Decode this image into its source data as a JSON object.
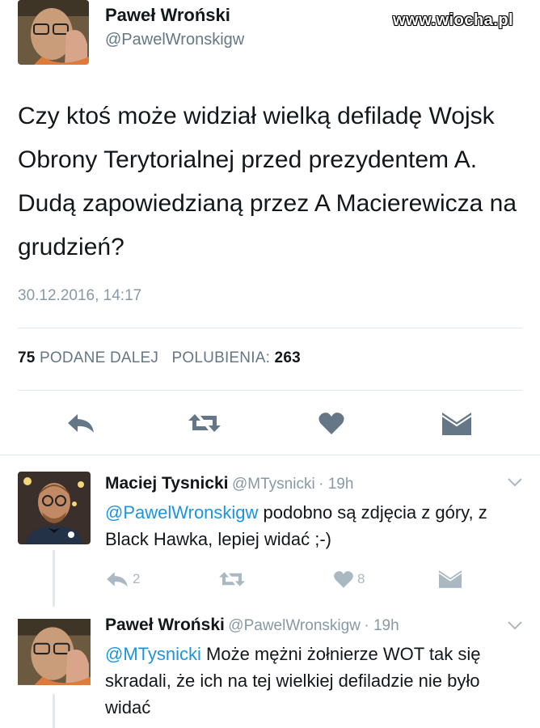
{
  "watermark": "www.wiocha.pl",
  "main_tweet": {
    "author_name": "Paweł Wroński",
    "author_handle": "@PawelWronskigw",
    "text": "Czy ktoś może widział wielką defiladę Wojsk Obrony Terytorialnej przed prezydentem A. Dudą zapowiedzianą przez A Macierewicza na grudzień?",
    "timestamp": "30.12.2016, 14:17",
    "retweets_count": "75",
    "retweets_label": "PODANE DALEJ",
    "likes_label": "POLUBIENIA:",
    "likes_count": "263"
  },
  "replies": [
    {
      "author_name": "Maciej Tysnicki",
      "author_handle": "@MTysnicki",
      "time": "· 19h",
      "mention": "@PawelWronskigw",
      "text": " podobno są zdjęcia z góry, z Black Hawka, lepiej widać ;-)",
      "reply_count": "2",
      "like_count": "8"
    },
    {
      "author_name": "Paweł Wroński",
      "author_handle": "@PawelWronskigw",
      "time": "· 19h",
      "mention": "@MTysnicki",
      "text": " Może mężni żołnierze WOT tak się skradali, że ich na tej wielkiej defiladzie nie było widać"
    }
  ],
  "colors": {
    "accent": "#1b95e0",
    "icon_gray": "#657786",
    "light_gray": "#aab8c2"
  }
}
